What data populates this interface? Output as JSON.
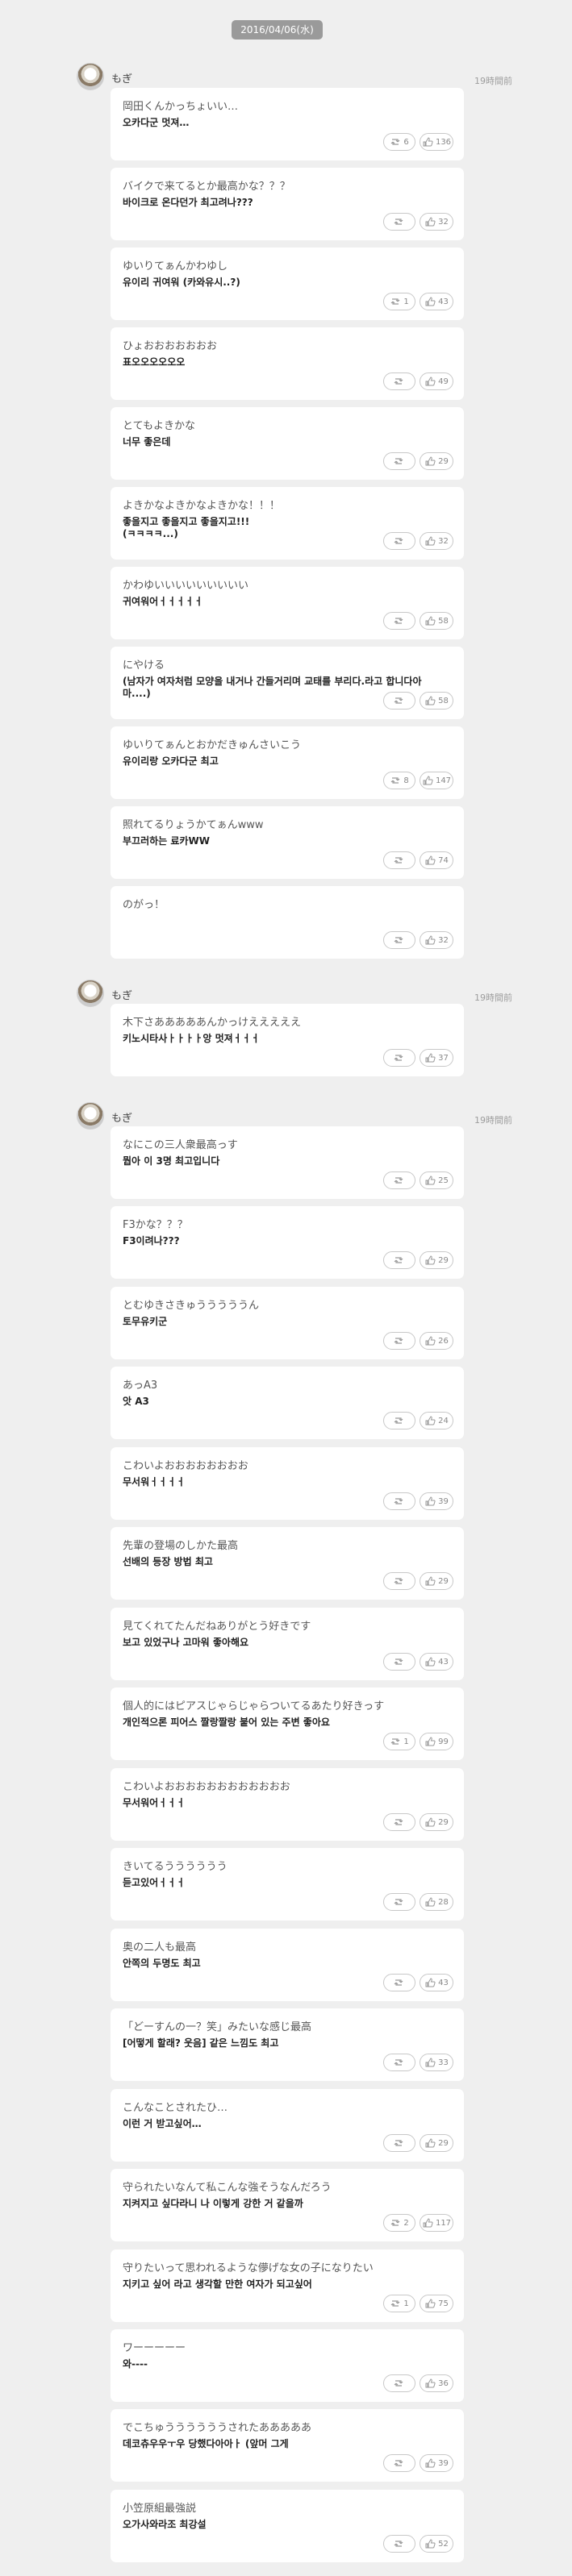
{
  "date": "2016/04/06(水)",
  "groups": [
    {
      "user": "もぎ",
      "time": "19時間前",
      "posts": [
        {
          "jp": "岡田くんかっちょいい…",
          "ko": "오카다군 멋져…",
          "rt": "6",
          "likes": "136"
        },
        {
          "jp": "バイクで来てるとか最高かな？？？",
          "ko": "바이크로 온다던가 최고려나???",
          "rt": "",
          "likes": "32"
        },
        {
          "jp": "ゆいりてぁんかわゆし",
          "ko": "유이리 귀여워 (카와유시..?)",
          "rt": "1",
          "likes": "43"
        },
        {
          "jp": "ひょおおおおおおお",
          "ko": "표오오오오오오",
          "rt": "",
          "likes": "49"
        },
        {
          "jp": "とてもよきかな",
          "ko": "너무 좋은데",
          "rt": "",
          "likes": "29"
        },
        {
          "jp": "よきかなよきかなよきかな！！！",
          "ko": "좋을지고 좋을지고 좋을지고!!!\n(ㅋㅋㅋㅋ...)",
          "rt": "",
          "likes": "32"
        },
        {
          "jp": "かわゆいいいいいいいいい",
          "ko": "귀여워어ㅓㅓㅓㅓㅓ",
          "rt": "",
          "likes": "58"
        },
        {
          "jp": "にやける",
          "ko": "(남자가 여자처럼 모양을 내거나 간들거리며 교태를 부리다.라고 합니다아마....)",
          "rt": "",
          "likes": "58"
        },
        {
          "jp": "ゆいりてぁんとおかだきゅんさいこう",
          "ko": "유이리랑 오카다군 최고",
          "rt": "8",
          "likes": "147"
        },
        {
          "jp": "照れてるりょうかてぁんwww",
          "ko": "부끄러하는 료카WW",
          "rt": "",
          "likes": "74"
        },
        {
          "jp": "のがっ！",
          "ko": "",
          "rt": "",
          "likes": "32"
        }
      ]
    },
    {
      "user": "もぎ",
      "time": "19時間前",
      "posts": [
        {
          "jp": "木下さあああああんかっけえええええ",
          "ko": "키노시타사ㅏㅏㅏㅏ앙 멋져ㅓㅓㅓ",
          "rt": "",
          "likes": "37"
        }
      ]
    },
    {
      "user": "もぎ",
      "time": "19時間前",
      "posts": [
        {
          "jp": "なにこの三人衆最高っす",
          "ko": "뭡아 이 3명 최고입니다",
          "rt": "",
          "likes": "25"
        },
        {
          "jp": "F3かな？？？",
          "ko": "F3이려나???",
          "rt": "",
          "likes": "29"
        },
        {
          "jp": "とむゆきさきゅうううううん",
          "ko": "토무유키군",
          "rt": "",
          "likes": "26"
        },
        {
          "jp": "あっA3",
          "ko": "앗 A3",
          "rt": "",
          "likes": "24"
        },
        {
          "jp": "こわいよおおおおおおおお",
          "ko": "무서워ㅓㅓㅓㅓ",
          "rt": "",
          "likes": "39"
        },
        {
          "jp": "先輩の登場のしかた最高",
          "ko": "선배의 등장 방법 최고",
          "rt": "",
          "likes": "29"
        },
        {
          "jp": "見てくれてたんだねありがとう好きです",
          "ko": "보고 있었구나 고마워 좋아해요",
          "rt": "",
          "likes": "43"
        },
        {
          "jp": "個人的にはピアスじゃらじゃらついてるあたり好きっす",
          "ko": "개인적으론 피어스 짤랑짤랑 붙어 있는 주변 좋아요",
          "rt": "1",
          "likes": "99"
        },
        {
          "jp": "こわいよおおおおおおおおおおおお",
          "ko": "무서워어ㅓㅓㅓ",
          "rt": "",
          "likes": "29"
        },
        {
          "jp": "きいてるうううううう",
          "ko": "듣고있어ㅓㅓㅓ",
          "rt": "",
          "likes": "28"
        },
        {
          "jp": "奥の二人も最高",
          "ko": "안쪽의 두명도 최고",
          "rt": "",
          "likes": "43"
        },
        {
          "jp": "「どーすんの一？笑」みたいな感じ最高",
          "ko": "[어떻게 할래? 웃음] 같은 느낌도 최고",
          "rt": "",
          "likes": "33"
        },
        {
          "jp": "こんなことされたひ…",
          "ko": "이런 거 받고싶어…",
          "rt": "",
          "likes": "29"
        },
        {
          "jp": "守られたいなんて私こんな強そうなんだろう",
          "ko": "지켜지고 싶다라니 나 이렇게 강한 거 같을까",
          "rt": "2",
          "likes": "117"
        },
        {
          "jp": "守りたいって思われるような儚げな女の子になりたい",
          "ko": "지키고 싶어 라고 생각할 만한 여자가 되고싶어",
          "rt": "1",
          "likes": "75"
        },
        {
          "jp": "ワーーーーー",
          "ko": "와----",
          "rt": "",
          "likes": "36"
        },
        {
          "jp": "でこちゅううううううされたあああああ",
          "ko": "데코츄우우ㅜ우 당했다아아ㅏ (앞머 그게",
          "rt": "",
          "likes": "39"
        },
        {
          "jp": "小笠原組最強説",
          "ko": "오가사와라조 최강설",
          "rt": "",
          "likes": "52"
        }
      ]
    }
  ]
}
